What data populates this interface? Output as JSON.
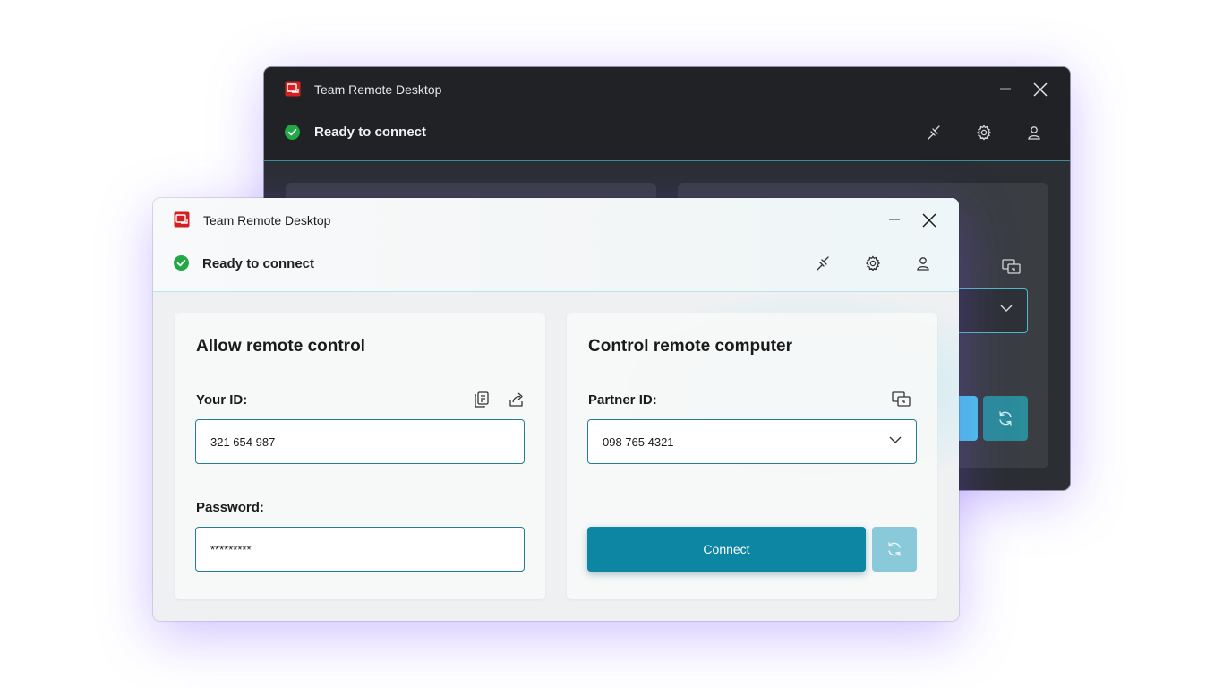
{
  "app": {
    "title": "Team Remote Desktop",
    "status": "Ready to connect"
  },
  "toolbar_icons": [
    "disconnect-icon",
    "gear-icon",
    "user-icon"
  ],
  "allow_panel": {
    "title": "Allow remote control",
    "id_label": "Your ID:",
    "id_value": "321 654 987",
    "password_label": "Password:",
    "password_value": "*********"
  },
  "control_panel": {
    "title": "Control remote computer",
    "partner_label": "Partner ID:",
    "partner_value": "098 765 4321",
    "connect_label": "Connect"
  },
  "colors": {
    "accent": "#0d86a3",
    "accent_light": "#8ac9d9",
    "status_ok": "#22a844",
    "logo_red": "#d32121",
    "dark_bg": "#212226",
    "shadow_glow": "#7850ff"
  }
}
